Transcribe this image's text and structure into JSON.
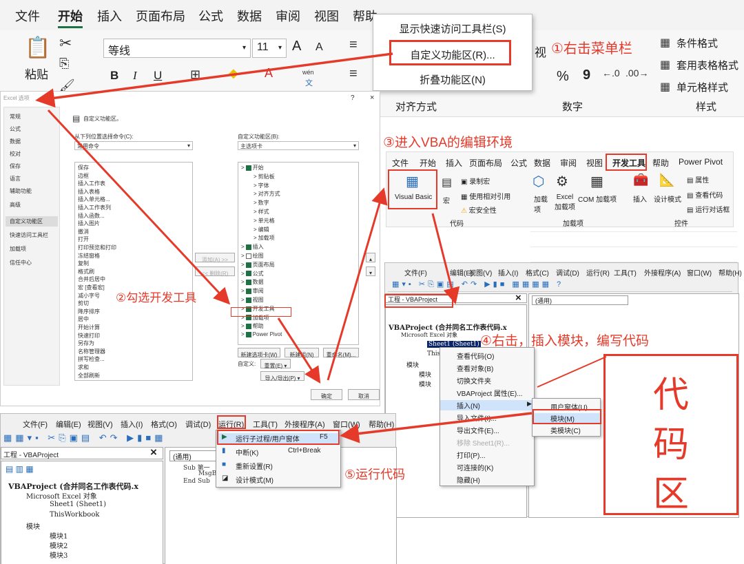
{
  "ribbon": {
    "tabs": [
      "文件",
      "开始",
      "插入",
      "页面布局",
      "公式",
      "数据",
      "审阅",
      "视图",
      "帮助",
      "Power Pivot"
    ],
    "paste_label": "粘贴",
    "font_name": "等线",
    "font_size": "11",
    "font_grow": "A",
    "font_shrink": "A",
    "bold": "B",
    "italic": "I",
    "underline": "U",
    "phonetic_top": "wén",
    "phonetic_bottom": "文",
    "view_fragment": "视",
    "group_align": "对齐方式",
    "group_number": "数字",
    "group_style": "样式",
    "percent": "%",
    "comma": "9",
    "cond_format": "条件格式",
    "table_format": "套用表格格式",
    "cell_style": "单元格样式"
  },
  "context_menu_1": {
    "items": [
      "显示快速访问工具栏(S)",
      "自定义功能区(R)...",
      "折叠功能区(N)"
    ]
  },
  "annotations": {
    "step1": "①右击菜单栏",
    "step2": "②勾选开发工具",
    "step3": "③进入VBA的编辑环境",
    "step4": "④右击，插入模块，编写代码",
    "step5": "⑤运行代码",
    "code_area": [
      "代",
      "码",
      "区"
    ]
  },
  "options_dialog": {
    "title": "Excel 选项",
    "help": "?",
    "close": "×",
    "nav": [
      "常规",
      "公式",
      "数据",
      "校对",
      "保存",
      "语言",
      "辅助功能",
      "高级",
      "自定义功能区",
      "快速访问工具栏",
      "加载项",
      "信任中心"
    ],
    "heading": "自定义功能区。",
    "left_label": "从下列位置选择命令(C):",
    "left_select": "常用命令",
    "right_label": "自定义功能区(B):",
    "right_select": "主选项卡",
    "commands": [
      "保存",
      "边框",
      "插入工作表",
      "插入表格",
      "插入单元格...",
      "插入工作表列",
      "插入函数...",
      "插入图片",
      "撤消",
      "打开",
      "打印预览和打印",
      "冻结窗格",
      "复制",
      "格式刷",
      "合并后居中",
      "宏 [查看宏]",
      "减小字号",
      "剪切",
      "降序排序",
      "居中",
      "开始计算",
      "快速打印",
      "另存为",
      "名称管理器",
      "拼写检查...",
      "求和",
      "全部刷新"
    ],
    "tree": [
      "开始",
      "剪贴板",
      "字体",
      "对齐方式",
      "数字",
      "样式",
      "单元格",
      "编辑",
      "加载项",
      "插入",
      "绘图",
      "页面布局",
      "公式",
      "数据",
      "审阅",
      "视图",
      "开发工具",
      "加载项",
      "帮助",
      "Power Pivot"
    ],
    "add_btn": "添加(A) >>",
    "remove_btn": "<< 删除(R)",
    "new_tab": "新建选项卡(W)",
    "new_group": "新建组(N)",
    "rename": "重命名(M)...",
    "customize_label": "自定义:",
    "reset": "重置(E) ▾",
    "import_export": "导入/导出(P) ▾",
    "ok": "确定",
    "cancel": "取消"
  },
  "dev_ribbon": {
    "tabs": [
      "文件",
      "开始",
      "插入",
      "页面布局",
      "公式",
      "数据",
      "审阅",
      "视图",
      "开发工具",
      "帮助",
      "Power Pivot"
    ],
    "vb": "Visual Basic",
    "macro": "宏",
    "record": "录制宏",
    "relative": "使用相对引用",
    "security": "宏安全性",
    "group_code": "代码",
    "addins": "加载项",
    "excel_addins": "Excel 加载项",
    "com_addins": "COM 加载项",
    "group_addins": "加载项",
    "insert": "插入",
    "design": "设计模式",
    "props": "属性",
    "view_code": "查看代码",
    "run_dialog": "运行对话框",
    "group_controls": "控件"
  },
  "vbe_right": {
    "menus": [
      "文件(F)",
      "编辑(E)",
      "视图(V)",
      "插入(I)",
      "格式(C)",
      "调试(D)",
      "运行(R)",
      "工具(T)",
      "外接程序(A)",
      "窗口(W)",
      "帮助(H)"
    ],
    "project_title": "工程 - VBAProject",
    "close": "×",
    "general": "(通用)",
    "tree": [
      "VBAProject (合并同名工作表代码.x",
      "Microsoft Excel 对象",
      "Sheet1 (Sheet1)",
      "This",
      "模块",
      "模块",
      "模块"
    ],
    "ctx_items": [
      "查看代码(O)",
      "查看对象(B)",
      "切换文件夹",
      "VBAProject 属性(E)...",
      "插入(N)",
      "导入文件(I)...",
      "导出文件(E)...",
      "移除 Sheet1(R)...",
      "打印(P)...",
      "可连接的(K)",
      "隐藏(H)"
    ],
    "sub_items": [
      "用户窗体(U)",
      "模块(M)",
      "类模块(C)"
    ]
  },
  "vbe_bottom": {
    "menus": [
      "文件(F)",
      "编辑(E)",
      "视图(V)",
      "插入(I)",
      "格式(O)",
      "调试(D)",
      "运行(R)",
      "工具(T)",
      "外接程序(A)",
      "窗口(W)",
      "帮助(H)"
    ],
    "project_title": "工程 - VBAProject",
    "close": "×",
    "general": "(通用)",
    "code_lines": [
      "Sub 第一",
      "MsgB",
      "End Sub"
    ],
    "tree": [
      "VBAProject (合并同名工作表代码.x",
      "Microsoft Excel 对象",
      "Sheet1 (Sheet1)",
      "ThisWorkbook",
      "模块",
      "模块1",
      "模块2",
      "模块3"
    ],
    "run_items": [
      "运行子过程/用户窗体",
      "中断(K)",
      "重新设置(R)",
      "设计模式(M)"
    ],
    "run_shortcuts": [
      "F5",
      "Ctrl+Break"
    ]
  },
  "colors": {
    "accent_red": "#e53a2a",
    "excel_green": "#1e7145"
  }
}
